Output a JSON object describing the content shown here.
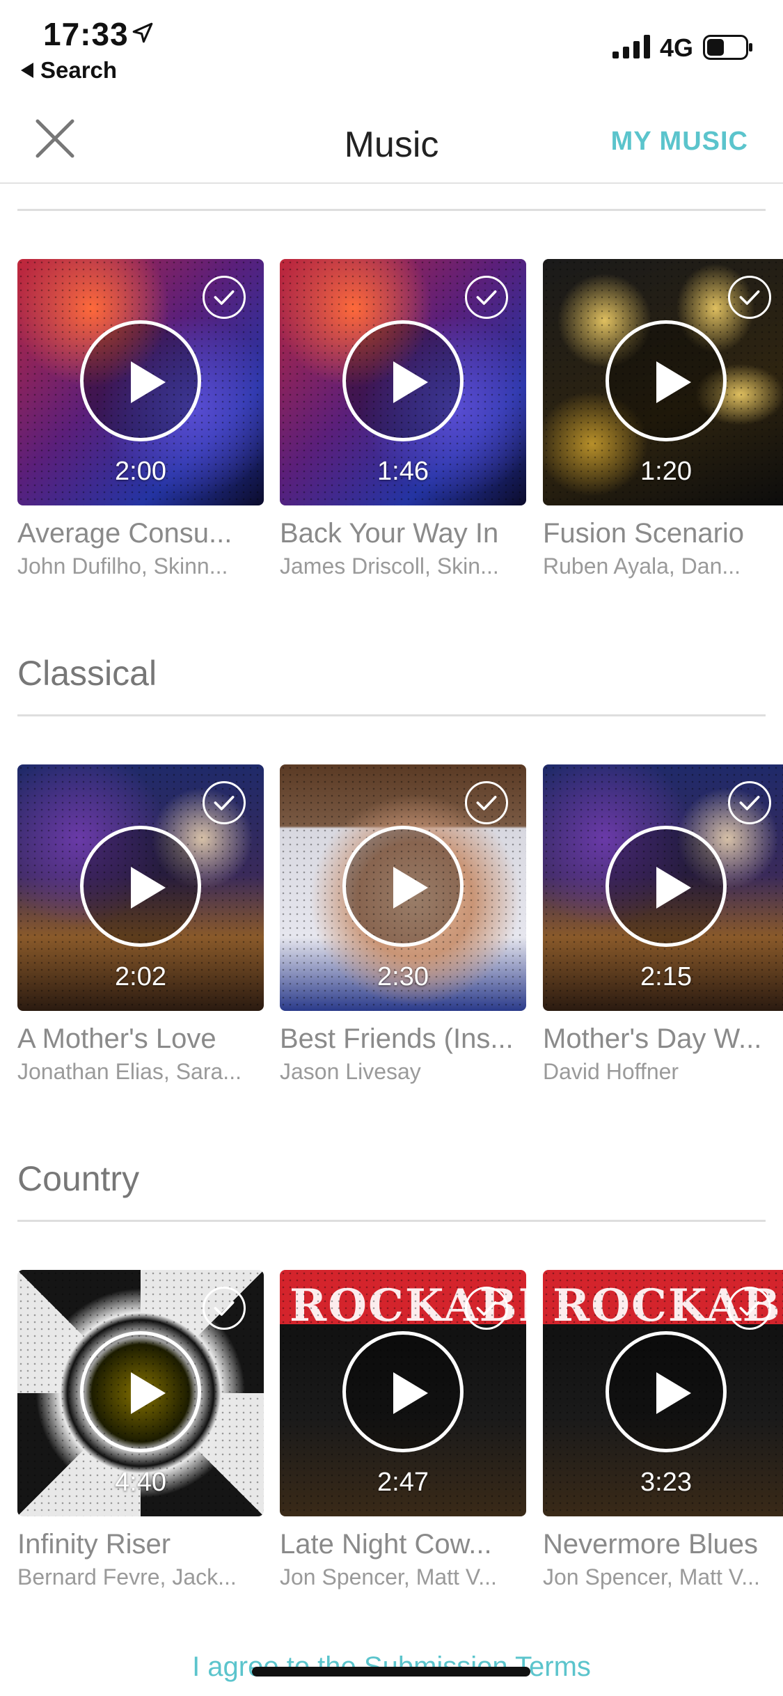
{
  "status_bar": {
    "time": "17:33",
    "back_label": "Search",
    "network": "4G",
    "battery_level": 0.45
  },
  "nav": {
    "title": "Music",
    "my_music_label": "MY MUSIC"
  },
  "sections": [
    {
      "title": "",
      "tracks": [
        {
          "title": "Average Consu...",
          "artist": "John Dufilho, Skinn...",
          "duration": "2:00",
          "selected": true,
          "art": "rock"
        },
        {
          "title": "Back Your Way In",
          "artist": "James Driscoll, Skin...",
          "duration": "1:46",
          "selected": true,
          "art": "rock"
        },
        {
          "title": "Fusion Scenario",
          "artist": "Ruben Ayala, Dan...",
          "duration": "1:20",
          "selected": true,
          "art": "fusion"
        }
      ]
    },
    {
      "title": "Classical",
      "tracks": [
        {
          "title": "A Mother's Love",
          "artist": "Jonathan Elias, Sara...",
          "duration": "2:02",
          "selected": true,
          "art": "inspire"
        },
        {
          "title": "Best Friends (Ins...",
          "artist": "Jason Livesay",
          "duration": "2:30",
          "selected": true,
          "art": "face"
        },
        {
          "title": "Mother's Day W...",
          "artist": "David Hoffner",
          "duration": "2:15",
          "selected": true,
          "art": "inspire"
        }
      ]
    },
    {
      "title": "Country",
      "tracks": [
        {
          "title": "Infinity Riser",
          "artist": "Bernard Fevre, Jack...",
          "duration": "4:40",
          "selected": true,
          "art": "infinity"
        },
        {
          "title": "Late Night Cow...",
          "artist": "Jon Spencer, Matt V...",
          "duration": "2:47",
          "selected": true,
          "art": "rocka"
        },
        {
          "title": "Nevermore Blues",
          "artist": "Jon Spencer, Matt V...",
          "duration": "3:23",
          "selected": true,
          "art": "rocka"
        }
      ]
    }
  ],
  "album_art_text": {
    "rocka": "ROCKABI"
  },
  "footer": {
    "terms_label": "I agree to the Submission Terms"
  },
  "colors": {
    "accent": "#5bc4cc",
    "section_title": "#777777",
    "divider": "#dedede"
  },
  "icons": {
    "close": "close-icon",
    "play": "play-icon",
    "check": "check-icon",
    "location": "location-arrow-icon",
    "signal": "signal-bars-icon",
    "battery": "battery-icon"
  }
}
